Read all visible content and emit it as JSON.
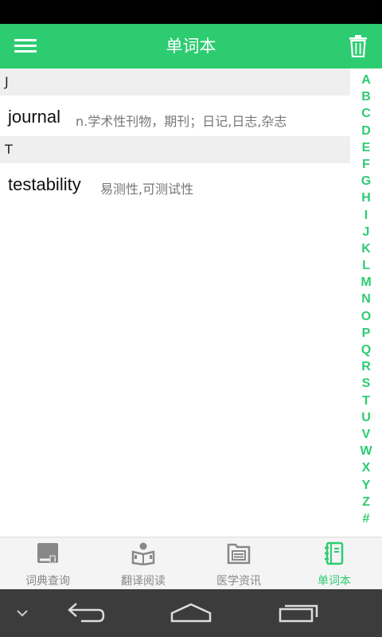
{
  "app_bar": {
    "title": "单词本",
    "menu_icon": "hamburger-menu-icon",
    "trash_icon": "trash-icon"
  },
  "sections": [
    {
      "letter": "J",
      "entries": [
        {
          "word": "journal",
          "definition": "n.学术性刊物，期刊；日记,日志,杂志"
        }
      ]
    },
    {
      "letter": "T",
      "entries": [
        {
          "word": "testability",
          "definition": "易测性,可测试性"
        }
      ]
    }
  ],
  "alpha_index": [
    "A",
    "B",
    "C",
    "D",
    "E",
    "F",
    "G",
    "H",
    "I",
    "J",
    "K",
    "L",
    "M",
    "N",
    "O",
    "P",
    "Q",
    "R",
    "S",
    "T",
    "U",
    "V",
    "W",
    "X",
    "Y",
    "Z",
    "#"
  ],
  "tabs": [
    {
      "label": "词典查询",
      "icon": "dictionary-book-icon",
      "active": false
    },
    {
      "label": "翻译阅读",
      "icon": "reading-person-icon",
      "active": false
    },
    {
      "label": "医学资讯",
      "icon": "news-folder-icon",
      "active": false
    },
    {
      "label": "单词本",
      "icon": "notebook-icon",
      "active": true
    }
  ],
  "colors": {
    "accent": "#2ecc71",
    "tab_inactive": "#888888",
    "section_bg": "#efefef"
  }
}
